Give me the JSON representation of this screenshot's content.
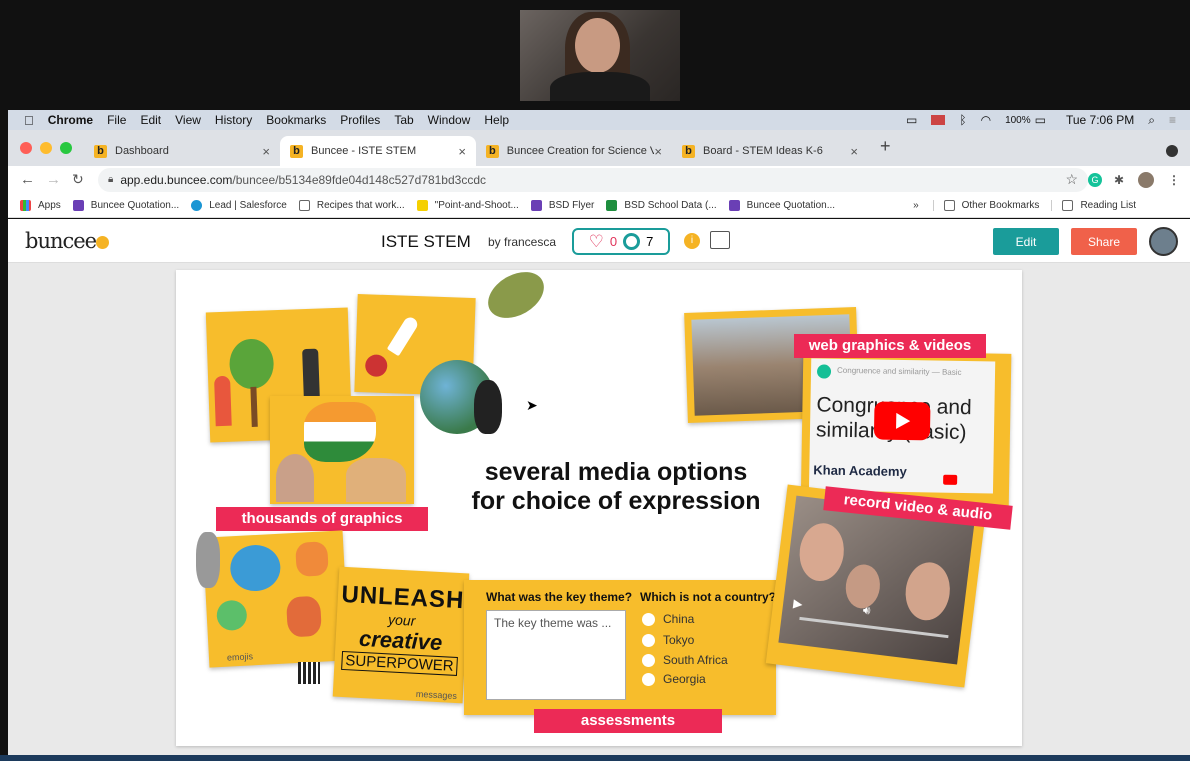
{
  "menubar": {
    "apple": "",
    "app": "Chrome",
    "items": [
      "File",
      "Edit",
      "View",
      "History",
      "Bookmarks",
      "Profiles",
      "Tab",
      "Window",
      "Help"
    ],
    "battery": "100%",
    "clock": "Tue 7:06 PM"
  },
  "tabs": [
    {
      "label": "Dashboard",
      "active": false
    },
    {
      "label": "Buncee - ISTE STEM",
      "active": true
    },
    {
      "label": "Buncee Creation for Science Vi",
      "active": false
    },
    {
      "label": "Board - STEM Ideas K-6",
      "active": false
    }
  ],
  "address": {
    "host": "app.edu.buncee.com",
    "path": "/buncee/b5134e89fde04d148c527d781bd3ccdc"
  },
  "bookmarks": [
    {
      "label": "Apps",
      "color": "#e44"
    },
    {
      "label": "Buncee Quotation...",
      "color": "#6a3fb5"
    },
    {
      "label": "Lead | Salesforce",
      "color": "#1b96d4"
    },
    {
      "label": "Recipes that work...",
      "color": "#888"
    },
    {
      "label": "\"Point-and-Shoot...",
      "color": "#f5d000"
    },
    {
      "label": "BSD Flyer",
      "color": "#6a3fb5"
    },
    {
      "label": "BSD School Data (...",
      "color": "#1e8e3e"
    },
    {
      "label": "Buncee Quotation...",
      "color": "#6a3fb5"
    }
  ],
  "bookmarks_right": {
    "more": "»",
    "other": "Other Bookmarks",
    "reading": "Reading List"
  },
  "header": {
    "logo": "buncee",
    "title": "ISTE STEM",
    "author": "by francesca",
    "likes": "0",
    "views": "7",
    "edit": "Edit",
    "share": "Share"
  },
  "colors": {
    "accent": "#1a9c9a",
    "share": "#f0614a",
    "yellow": "#f7bd2c",
    "pink": "#ec2a56"
  },
  "slide": {
    "headline_1": "several media options",
    "headline_2": "for choice of expression",
    "label_graphics": "thousands of graphics",
    "label_web": "web graphics & videos",
    "label_record": "record video & audio",
    "label_assess": "assessments",
    "emojis": "emojis",
    "messages": "messages",
    "unleash": [
      "UNLEASH",
      "your",
      "creative",
      "SUPERPOWER"
    ],
    "video": {
      "channel_title": "Congruence and similarity — Basic",
      "text_1": "Congruence and",
      "text_2": "similarity (basic)",
      "brand": "Khan Academy"
    },
    "quiz": {
      "q1": "What was the key theme?",
      "q1_placeholder": "The key theme was ...",
      "q2": "Which is not a country?",
      "options": [
        "China",
        "Tokyo",
        "South Africa",
        "Georgia"
      ]
    }
  }
}
